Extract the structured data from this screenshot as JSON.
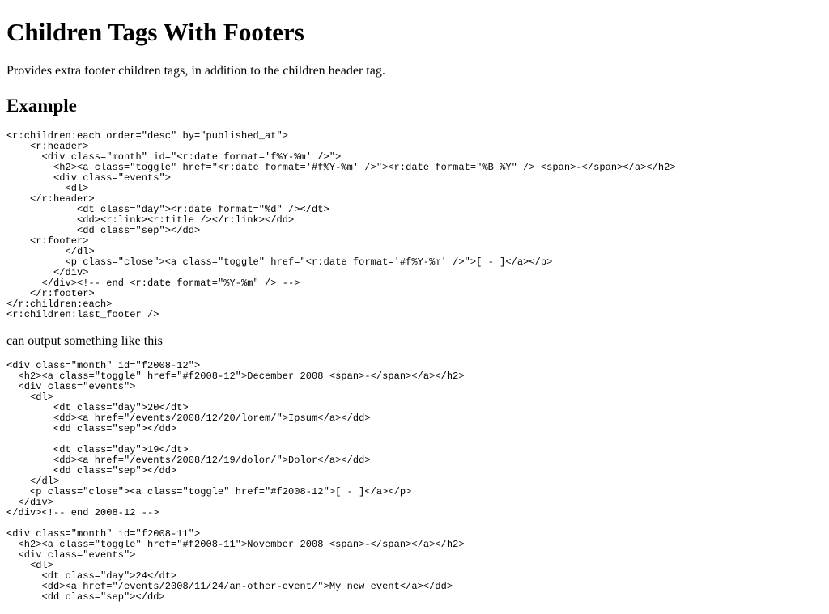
{
  "heading": "Children Tags With Footers",
  "intro": "Provides extra footer children tags, in addition to the children header tag.",
  "example_heading": "Example",
  "example_code": "<r:children:each order=\"desc\" by=\"published_at\">\n    <r:header>\n      <div class=\"month\" id=\"<r:date format='f%Y-%m' />\">\n        <h2><a class=\"toggle\" href=\"<r:date format='#f%Y-%m' />\"><r:date format=\"%B %Y\" /> <span>-</span></a></h2>\n        <div class=\"events\">\n          <dl>\n    </r:header>\n            <dt class=\"day\"><r:date format=\"%d\" /></dt>\n            <dd><r:link><r:title /></r:link></dd>\n            <dd class=\"sep\"></dd>\n    <r:footer>\n          </dl>\n          <p class=\"close\"><a class=\"toggle\" href=\"<r:date format='#f%Y-%m' />\">[ - ]</a></p>\n        </div>\n      </div><!-- end <r:date format=\"%Y-%m\" /> -->\n    </r:footer>\n</r:children:each>\n<r:children:last_footer />",
  "output_intro": "can output something like this",
  "output_code": "<div class=\"month\" id=\"f2008-12\">\n  <h2><a class=\"toggle\" href=\"#f2008-12\">December 2008 <span>-</span></a></h2>\n  <div class=\"events\">\n    <dl>\n        <dt class=\"day\">20</dt>\n        <dd><a href=\"/events/2008/12/20/lorem/\">Ipsum</a></dd>\n        <dd class=\"sep\"></dd>\n\n        <dt class=\"day\">19</dt>\n        <dd><a href=\"/events/2008/12/19/dolor/\">Dolor</a></dd>\n        <dd class=\"sep\"></dd>\n    </dl>\n    <p class=\"close\"><a class=\"toggle\" href=\"#f2008-12\">[ - ]</a></p>\n  </div>\n</div><!-- end 2008-12 -->\n\n<div class=\"month\" id=\"f2008-11\">\n  <h2><a class=\"toggle\" href=\"#f2008-11\">November 2008 <span>-</span></a></h2>\n  <div class=\"events\">\n    <dl>\n      <dt class=\"day\">24</dt>\n      <dd><a href=\"/events/2008/11/24/an-other-event/\">My new event</a></dd>\n      <dd class=\"sep\"></dd>"
}
